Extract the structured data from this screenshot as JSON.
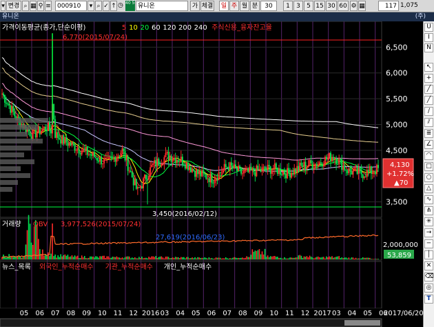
{
  "toolbar": {
    "menu_label": "변경",
    "code": "000910",
    "code_badge": "40\n50",
    "stock_name": "유니온",
    "chart_mode_buttons": [
      "가",
      "체결",
      "일",
      "주",
      "월",
      "분"
    ],
    "minute_value": "30 ",
    "interval_buttons": [
      "1",
      "3",
      "5",
      "15",
      "30",
      "60"
    ],
    "count_value": "117",
    "ratio_value": "1,075"
  },
  "titlebar": {
    "left": "유니온",
    "right": "(주)"
  },
  "panels": {
    "price_title": "가격이동평균(종가,단순이평)",
    "ma_labels": [
      {
        "text": "5",
        "color": "#ff3030"
      },
      {
        "text": "10",
        "color": "#ffff00"
      },
      {
        "text": "20",
        "color": "#00ff40"
      },
      {
        "text": "60",
        "color": "#ffffff"
      },
      {
        "text": "120",
        "color": "#ffffff"
      },
      {
        "text": "200",
        "color": "#ffffff"
      },
      {
        "text": "240",
        "color": "#ffffff"
      }
    ],
    "credit_label": "주식신용_융자잔고율",
    "max_annotation": "6,770(2015/07/24)",
    "min_annotation": "3,450(2016/02/12)",
    "volume_title": "거래량",
    "obv_title": "OBV",
    "obv_annotation": "3,977,526(2015/07/24)",
    "obv_low_annotation": "27,619(2016/06/23)",
    "bottom_items": [
      {
        "text": "뉴스_목록",
        "color": "#ffffff"
      },
      {
        "text": "외국인_누적순매수",
        "color": "#ff3030"
      },
      {
        "text": "기관_누적순매수",
        "color": "#ff3030"
      },
      {
        "text": "개인_누적순매수",
        "color": "#ffffff"
      }
    ]
  },
  "price_box": {
    "price": "4,130",
    "change_pct": "+1.72%",
    "change": "▲70"
  },
  "volume_box": {
    "value": "53,859"
  },
  "right_tools": [
    "U",
    "I",
    "N",
    "T"
  ],
  "chart_data": {
    "type": "candlestick",
    "price_axis": {
      "ticks": [
        "6,500",
        "6,000",
        "5,500",
        "5,000",
        "4,500",
        "3,500"
      ],
      "ylim": [
        3200,
        7000
      ]
    },
    "volume_axis": {
      "ticks": [
        "2,000,000"
      ]
    },
    "x_labels": [
      "05",
      "06",
      "07",
      "08",
      "09",
      "10",
      "11",
      "12",
      "2016",
      "03",
      "04",
      "05",
      "06",
      "07",
      "08",
      "09",
      "10",
      "11",
      "12",
      "2017",
      "03",
      "04",
      "05",
      "06"
    ],
    "date_range_label": "2017/06/20",
    "last_price": 4130,
    "max": {
      "value": 6770,
      "date": "2015/07/24"
    },
    "min": {
      "value": 3450,
      "date": "2016/02/12"
    },
    "monthly_close": [
      5600,
      5100,
      4800,
      4950,
      4700,
      4550,
      4400,
      4250,
      4500,
      3700,
      4200,
      4400,
      4300,
      4050,
      3950,
      4200,
      4050,
      4100,
      4150,
      4050,
      4200,
      4250,
      4400,
      4100,
      4050,
      4130
    ],
    "monthly_volume": [
      500000,
      300000,
      3977526,
      900000,
      450000,
      350000,
      300000,
      320000,
      280000,
      250000,
      300000,
      260000,
      240000,
      200000,
      190000,
      200000,
      300000,
      900000,
      350000,
      200000,
      400000,
      250000,
      300000,
      200000,
      180000,
      53859
    ]
  }
}
